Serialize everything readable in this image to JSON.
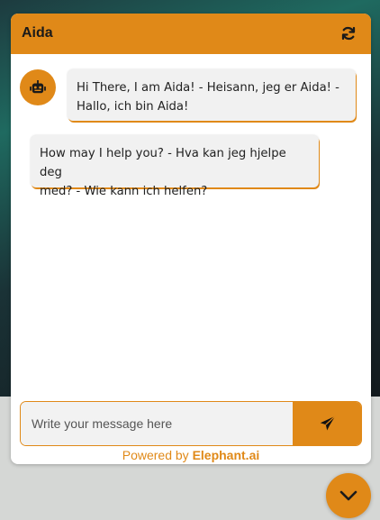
{
  "header": {
    "title": "Aida",
    "refresh_icon": "refresh-icon"
  },
  "messages": [
    {
      "sender": "bot",
      "avatar_icon": "robot-icon",
      "line1": "Hi There, I am Aida! - Heisann, jeg er Aida! -",
      "line2": "Hallo, ich bin Aida!"
    },
    {
      "sender": "bot",
      "line1": "How may I help you? - Hva kan jeg hjelpe deg",
      "line2": "med? - Wie kann ich helfen?"
    }
  ],
  "composer": {
    "placeholder": "Write your message here",
    "value": "",
    "send_icon": "paper-plane-icon"
  },
  "footer": {
    "prefix": "Powered by ",
    "brand": "Elephant.ai"
  },
  "launcher": {
    "icon": "chevron-down-icon"
  },
  "colors": {
    "accent": "#e08918",
    "bubble_bg": "#f1f1f1",
    "text": "#222222"
  }
}
